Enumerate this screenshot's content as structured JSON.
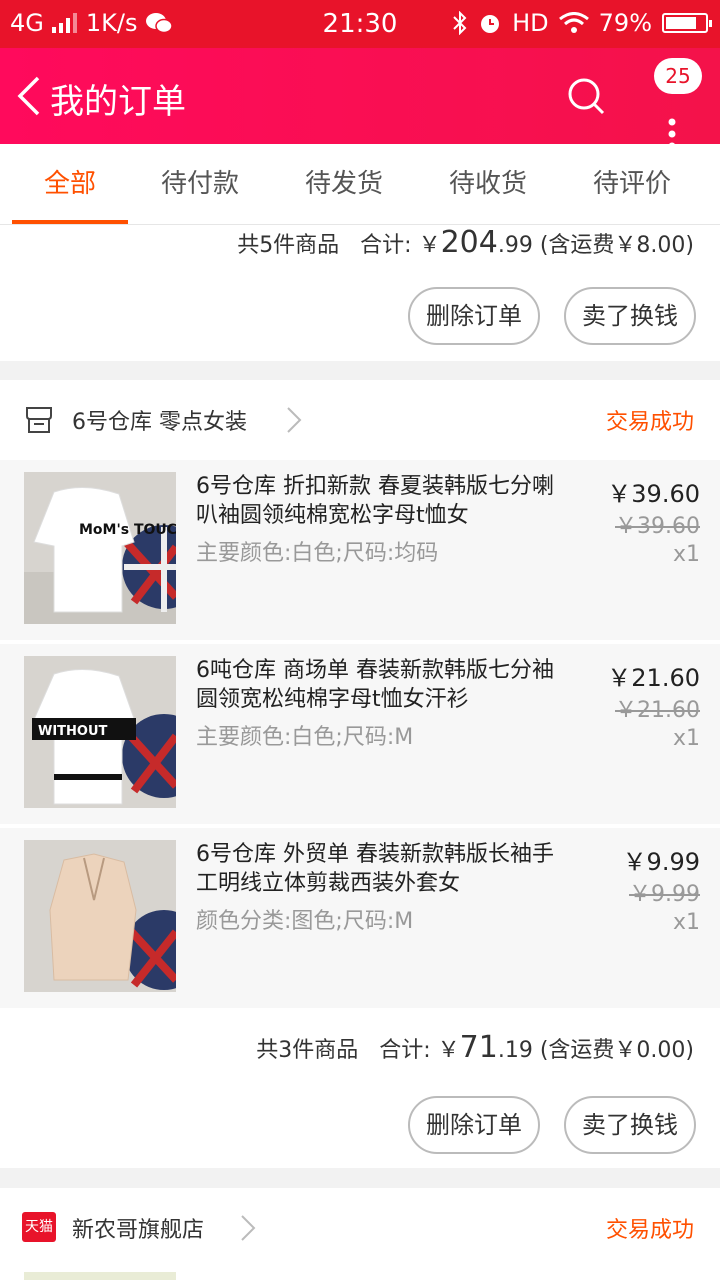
{
  "status_bar": {
    "network": "4G",
    "speed": "1K/s",
    "time": "21:30",
    "hd": "HD",
    "battery_pct": "79%",
    "battery_level": 0.79
  },
  "nav": {
    "title": "我的订单",
    "badge": "25"
  },
  "tabs": [
    "全部",
    "待付款",
    "待发货",
    "待收货",
    "待评价"
  ],
  "order1": {
    "summary_count": "共5件商品",
    "summary_total_label": "合计: ￥",
    "summary_total_big": "204",
    "summary_total_small": ".99",
    "summary_shipping": "(含运费￥8.00)",
    "btn_delete": "删除订单",
    "btn_sell": "卖了换钱"
  },
  "order2": {
    "store": "6号仓库 零点女装",
    "status": "交易成功",
    "items": [
      {
        "title": "6号仓库 折扣新款 春夏装韩版七分喇叭袖圆领纯棉宽松字母t恤女",
        "spec": "主要颜色:白色;尺码:均码",
        "price": "￥39.60",
        "orig_price": "￥39.60",
        "qty": "x1",
        "graphic_text": "MoM's TOUCH"
      },
      {
        "title": "6吨仓库 商场单 春装新款韩版七分袖圆领宽松纯棉字母t恤女汗衫",
        "spec": "主要颜色:白色;尺码:M",
        "price": "￥21.60",
        "orig_price": "￥21.60",
        "qty": "x1",
        "graphic_text": "WITHOUT"
      },
      {
        "title": "6号仓库 外贸单 春装新款韩版长袖手工明线立体剪裁西装外套女",
        "spec": "颜色分类:图色;尺码:M",
        "price": "￥9.99",
        "orig_price": "￥9.99",
        "qty": "x1",
        "graphic_text": ""
      }
    ],
    "summary_count": "共3件商品",
    "summary_total_label": "合计: ￥",
    "summary_total_big": "71",
    "summary_total_small": ".19",
    "summary_shipping": "(含运费￥0.00)",
    "btn_delete": "删除订单",
    "btn_sell": "卖了换钱"
  },
  "order3": {
    "store_badge": "天猫",
    "store": "新农哥旗舰店",
    "status": "交易成功"
  }
}
